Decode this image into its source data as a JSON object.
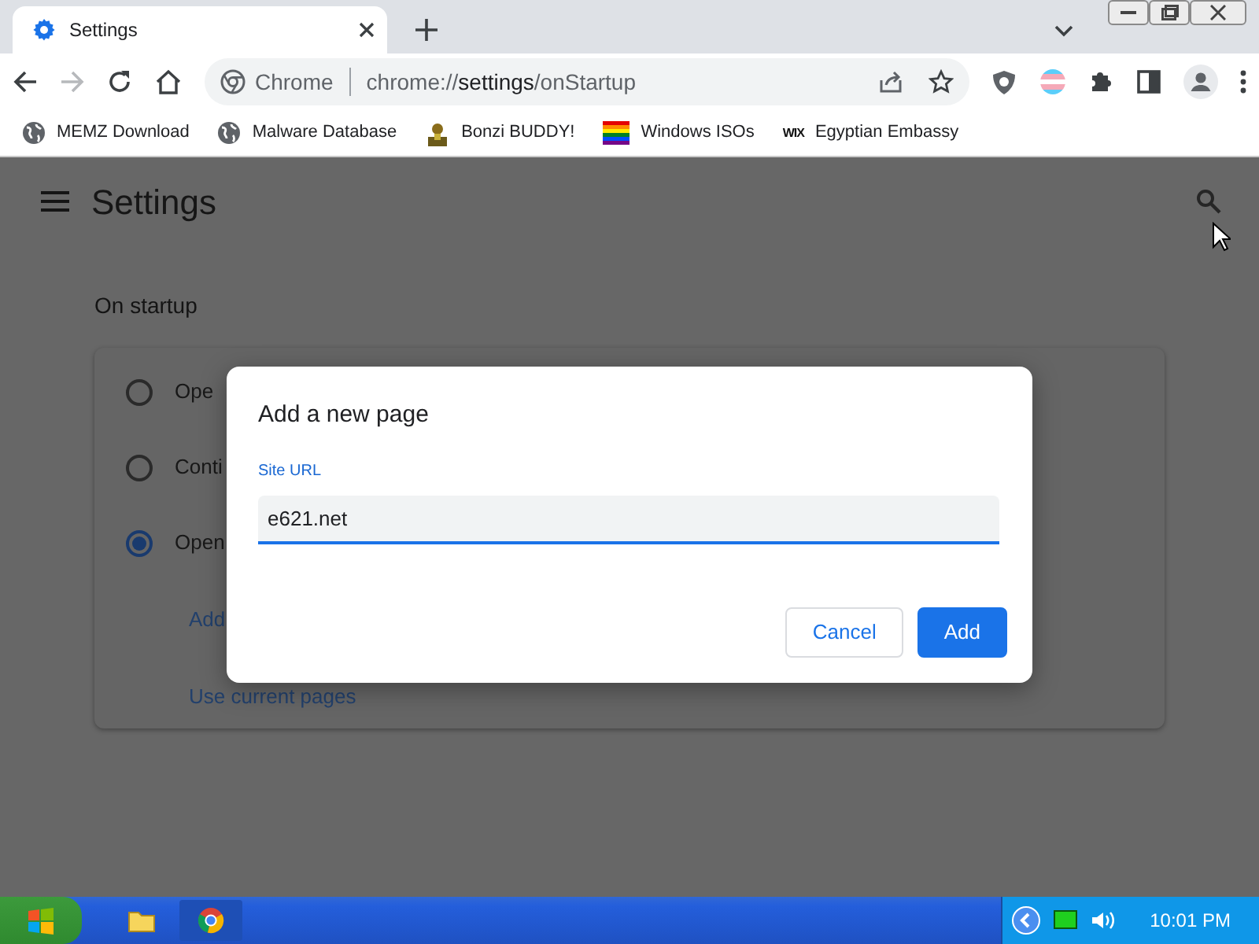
{
  "browser": {
    "tabs": [
      {
        "title": "Settings",
        "selected": true
      }
    ],
    "back_disabled": false,
    "forward_disabled": true,
    "omnibox": {
      "label": "Chrome",
      "url_scheme": "chrome://",
      "url_host": "settings",
      "url_path": "/onStartup"
    },
    "bookmarks": [
      {
        "kind": "globe",
        "title": "MEMZ Download"
      },
      {
        "kind": "globe",
        "title": "Malware Database"
      },
      {
        "kind": "bonzi",
        "title": "Bonzi BUDDY!"
      },
      {
        "kind": "rainbow",
        "title": "Windows ISOs"
      },
      {
        "kind": "wix",
        "icon_text": "WIX",
        "title": "Egyptian Embassy"
      }
    ]
  },
  "settings": {
    "title": "Settings",
    "section": "On startup",
    "options": [
      {
        "label": "Ope",
        "selected": false
      },
      {
        "label": "Conti",
        "selected": false
      },
      {
        "label": "Open",
        "selected": true
      }
    ],
    "links": [
      "Add",
      "Use current pages"
    ]
  },
  "dialog": {
    "title": "Add a new page",
    "field_label": "Site URL",
    "value": "e621.net",
    "buttons": [
      {
        "label": "Cancel",
        "kind": "secondary"
      },
      {
        "label": "Add",
        "kind": "primary"
      }
    ]
  },
  "taskbar": {
    "clock": "10:01 PM"
  }
}
